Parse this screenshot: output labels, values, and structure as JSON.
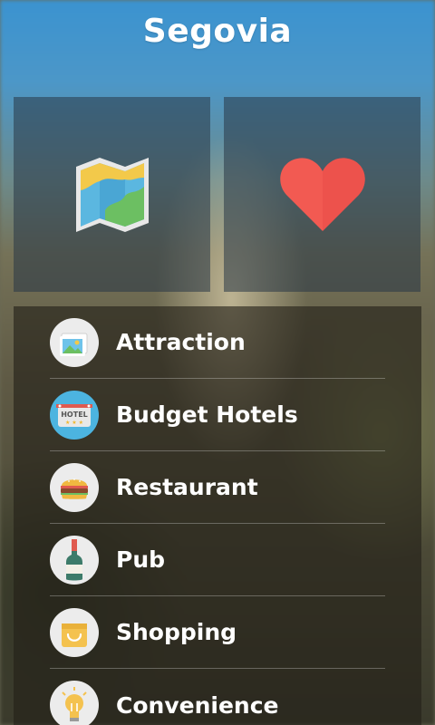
{
  "header": {
    "title": "Segovia"
  },
  "tiles": [
    {
      "name": "map-icon"
    },
    {
      "name": "heart-icon"
    }
  ],
  "menu": {
    "items": [
      {
        "label": "Attraction",
        "icon": "photo-icon"
      },
      {
        "label": "Budget Hotels",
        "icon": "hotel-icon"
      },
      {
        "label": "Restaurant",
        "icon": "burger-icon"
      },
      {
        "label": "Pub",
        "icon": "bottle-icon"
      },
      {
        "label": "Shopping",
        "icon": "shopping-bag-icon"
      },
      {
        "label": "Convenience",
        "icon": "lightbulb-icon"
      }
    ]
  },
  "colors": {
    "heart": "#f25a52",
    "icon_circle": "#ececec",
    "hotel_circle": "#4cb4e0"
  }
}
